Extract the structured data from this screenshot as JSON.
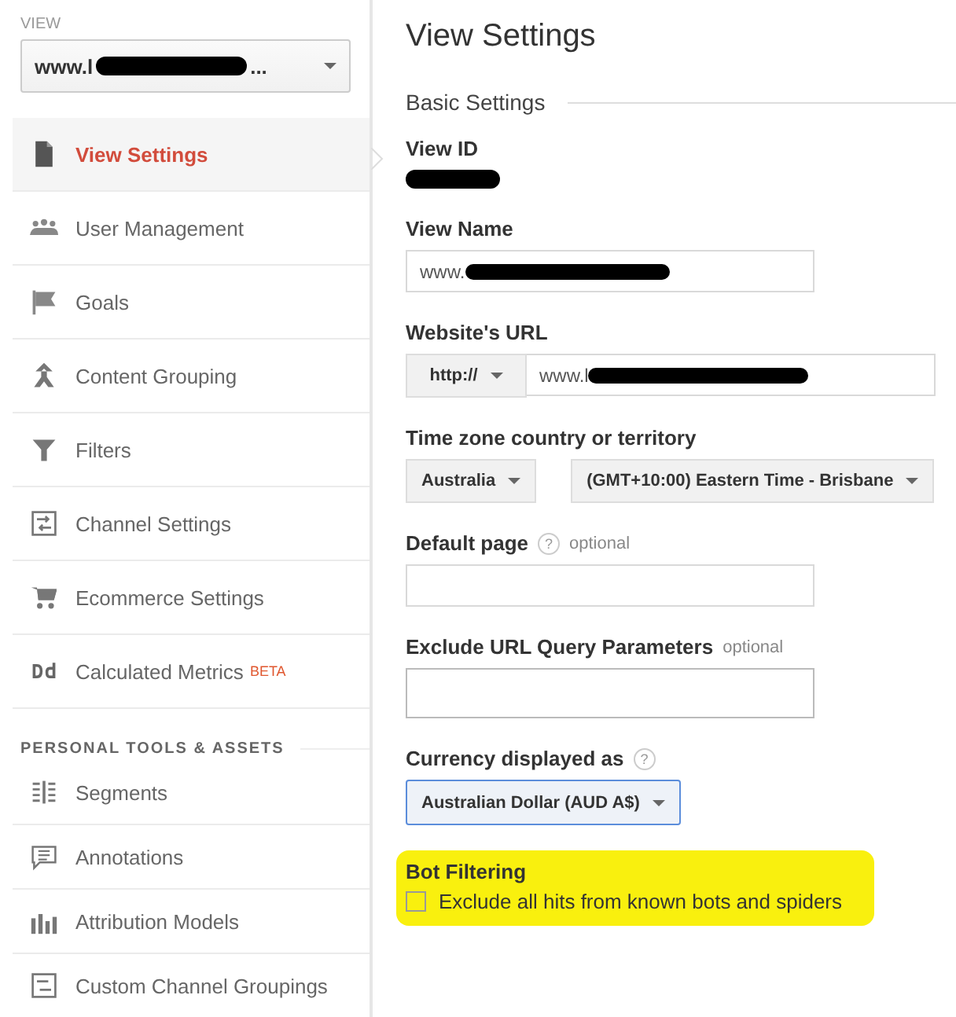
{
  "sidebar": {
    "view_label": "VIEW",
    "view_selector": {
      "value": "www.l",
      "suffix": "..."
    },
    "items": [
      {
        "label": "View Settings",
        "kind": "document",
        "selected": true
      },
      {
        "label": "User Management",
        "kind": "users",
        "selected": false
      },
      {
        "label": "Goals",
        "kind": "flag",
        "selected": false
      },
      {
        "label": "Content Grouping",
        "kind": "merge",
        "selected": false
      },
      {
        "label": "Filters",
        "kind": "filter",
        "selected": false
      },
      {
        "label": "Channel Settings",
        "kind": "channel",
        "selected": false
      },
      {
        "label": "Ecommerce Settings",
        "kind": "cart",
        "selected": false
      },
      {
        "label": "Calculated Metrics",
        "kind": "dd",
        "badge": "BETA",
        "selected": false
      }
    ],
    "section_title": "PERSONAL TOOLS & ASSETS",
    "tools": [
      {
        "label": "Segments",
        "kind": "segments",
        "selected": false
      },
      {
        "label": "Annotations",
        "kind": "comment",
        "selected": false
      },
      {
        "label": "Attribution Models",
        "kind": "bars",
        "selected": false
      },
      {
        "label": "Custom Channel Groupings",
        "kind": "channel",
        "selected": false
      }
    ]
  },
  "main": {
    "title": "View Settings",
    "section": "Basic Settings",
    "view_id": {
      "label": "View ID"
    },
    "view_name": {
      "label": "View Name",
      "value": "www."
    },
    "website_url": {
      "label": "Website's URL",
      "protocol": "http://",
      "value": "www.l"
    },
    "time_zone": {
      "label": "Time zone country or territory",
      "country": "Australia",
      "zone": "(GMT+10:00) Eastern Time - Brisbane"
    },
    "default_page": {
      "label": "Default page",
      "help": "?",
      "note": "optional"
    },
    "exclude_params": {
      "label": "Exclude URL Query Parameters",
      "note": "optional"
    },
    "currency": {
      "label": "Currency displayed as",
      "help": "?",
      "value": "Australian Dollar (AUD A$)"
    },
    "bot_filtering": {
      "label": "Bot Filtering",
      "option": "Exclude all hits from known bots and spiders",
      "checked": false
    }
  }
}
